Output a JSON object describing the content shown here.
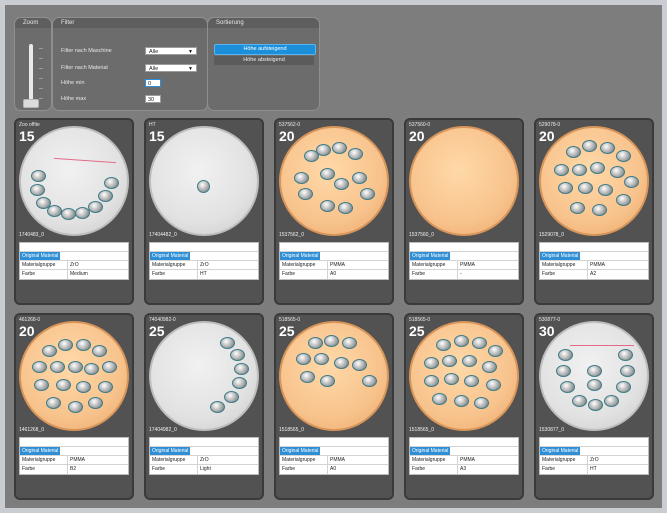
{
  "zoom": {
    "title": "Zoom"
  },
  "filter": {
    "title": "Filter",
    "rows": [
      {
        "label": "Filter nach Maschine",
        "value": "Alle"
      },
      {
        "label": "Filter nach Material",
        "value": "Alle"
      },
      {
        "label": "Höhe min",
        "value": "0"
      },
      {
        "label": "Höhe max",
        "value": "30"
      }
    ]
  },
  "sort": {
    "title": "Sortierung",
    "options": [
      "Höhe aufsteigend",
      "Höhe absteigend"
    ],
    "selected": "Höhe aufsteigend"
  },
  "table_labels": {
    "header": "Original Material",
    "group": "Materialgruppe",
    "color": "Farbe"
  },
  "cards": [
    {
      "header": "Zoo offite",
      "height": "15",
      "id": "1740483_0",
      "group": "ZrO",
      "color": "Medium"
    },
    {
      "header": "HT",
      "height": "15",
      "id": "17404482_0",
      "group": "ZrO",
      "color": "HT"
    },
    {
      "header": "537562-0",
      "height": "20",
      "id": "1537562_0",
      "group": "PMMA",
      "color": "A0"
    },
    {
      "header": "537560-0",
      "height": "20",
      "id": "1537560_0",
      "group": "PMMA",
      "color": "-"
    },
    {
      "header": "529078-0",
      "height": "20",
      "id": "1529078_0",
      "group": "PMMA",
      "color": "A2"
    },
    {
      "header": "461268-0",
      "height": "20",
      "id": "1461268_0",
      "group": "PMMA",
      "color": "B2"
    },
    {
      "header": "74040982-0",
      "height": "25",
      "id": "17404982_0",
      "group": "ZrO",
      "color": "Light"
    },
    {
      "header": "518565-0",
      "height": "25",
      "id": "1518565_0",
      "group": "PMMA",
      "color": "A0"
    },
    {
      "header": "518565-0",
      "height": "25",
      "id": "1518565_0",
      "group": "PMMA",
      "color": "A3"
    },
    {
      "header": "530877-0",
      "height": "30",
      "id": "1530877_0",
      "group": "ZrO",
      "color": "HT"
    }
  ]
}
